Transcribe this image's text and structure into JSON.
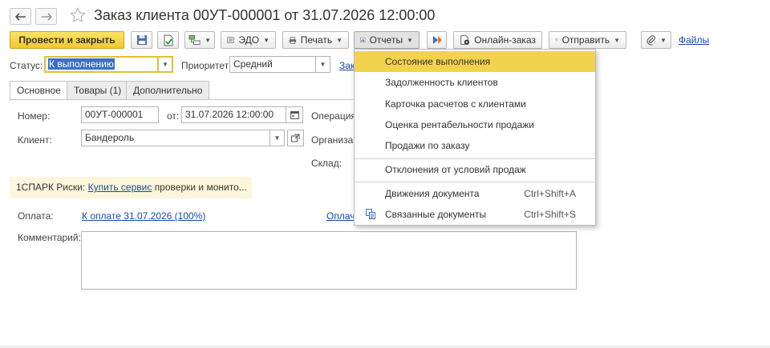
{
  "window": {
    "title": "Заказ клиента 00УТ-000001 от 31.07.2026 12:00:00"
  },
  "toolbar": {
    "post_close": "Провести и закрыть",
    "edo": "ЭДО",
    "print": "Печать",
    "reports": "Отчеты",
    "online_order": "Онлайн-заказ",
    "send": "Отправить",
    "files": "Файлы"
  },
  "status_row": {
    "status_label": "Статус:",
    "status_value": "К выполнению",
    "priority_label": "Приоритет:",
    "priority_value": "Средний",
    "truncated_link": "Зак"
  },
  "tabs": [
    {
      "label": "Основное"
    },
    {
      "label": "Товары (1)"
    },
    {
      "label": "Дополнительно"
    }
  ],
  "form": {
    "number_label": "Номер:",
    "number_value": "00УТ-000001",
    "date_label": "от:",
    "date_value": "31.07.2026 12:00:00",
    "operation_label": "Операция",
    "client_label": "Клиент:",
    "client_value": "Бандероль",
    "organization_label": "Организа",
    "warehouse_label": "Склад:",
    "spark_prefix": "1СПАРК Риски:",
    "spark_link": "Купить сервис",
    "spark_suffix": "проверки и монито...",
    "payment_label": "Оплата:",
    "payment_link": "К оплате 31.07.2026 (100%)",
    "payment_link2": "Оплач",
    "comment_label": "Комментарий:"
  },
  "reports_menu": {
    "items": [
      {
        "label": "Состояние выполнения",
        "shortcut": ""
      },
      {
        "label": "Задолженность клиентов",
        "shortcut": ""
      },
      {
        "label": "Карточка расчетов с клиентами",
        "shortcut": ""
      },
      {
        "label": "Оценка рентабельности продажи",
        "shortcut": ""
      },
      {
        "label": "Продажи по заказу",
        "shortcut": ""
      },
      {
        "label": "Отклонения от условий продаж",
        "shortcut": ""
      },
      {
        "label": "Движения документа",
        "shortcut": "Ctrl+Shift+A"
      },
      {
        "label": "Связанные документы",
        "shortcut": "Ctrl+Shift+S"
      }
    ]
  },
  "colors": {
    "primary_button": "#f1c82e",
    "menu_highlight": "#f3d24d",
    "link": "#1a4aa5",
    "spark_bg": "#fcf7dc"
  },
  "icons": [
    "back-arrow-icon",
    "forward-arrow-icon",
    "star-icon",
    "save-icon",
    "document-icon",
    "structure-icon",
    "printer-icon",
    "reports-icon",
    "dispatch-icon",
    "online-order-icon",
    "send-icon",
    "attachment-icon",
    "calendar-icon",
    "open-icon",
    "related-docs-icon"
  ]
}
